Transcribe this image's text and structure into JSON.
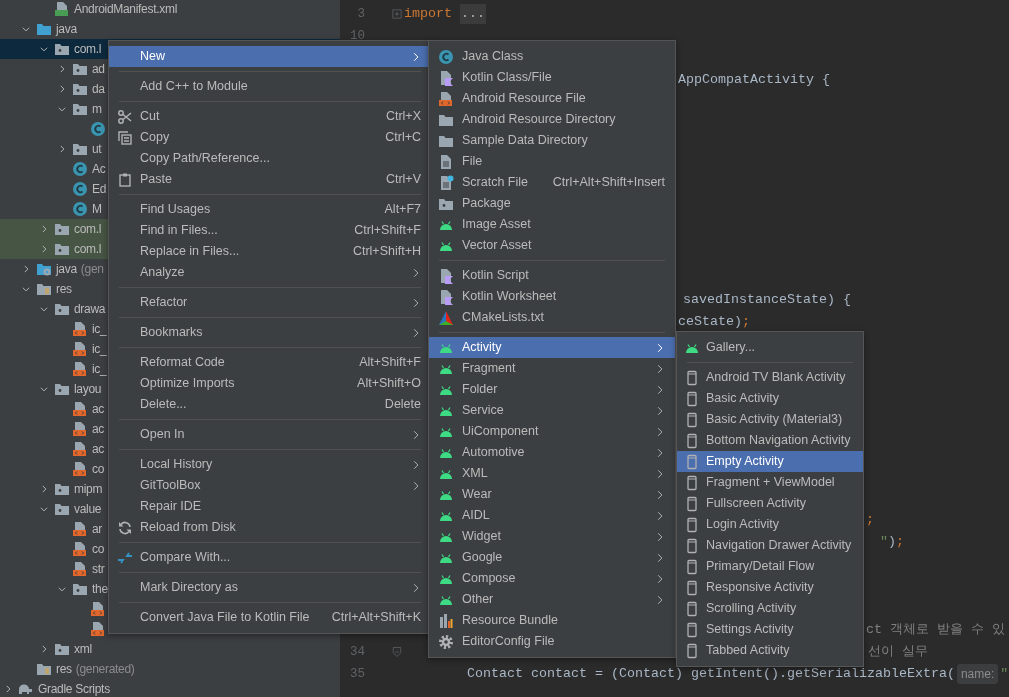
{
  "tree": {
    "items": [
      {
        "children": [
          {
            "children": [
              {
                "kind": "manifest",
                "label": "AndroidManifest.xml",
                "selected": false,
                "tinted": false
              }
            ]
          },
          {
            "kind": "javaroot",
            "label": "java",
            "expanded": true,
            "selected": false,
            "tinted": false,
            "children": [
              {
                "kind": "package",
                "label": "com.l",
                "expanded": true,
                "selected": true,
                "tinted": false,
                "children": [
                  {
                    "kind": "package",
                    "label": "ad",
                    "expanded": false,
                    "selected": false,
                    "tinted": false
                  },
                  {
                    "kind": "package",
                    "label": "da",
                    "expanded": false,
                    "selected": false,
                    "tinted": false
                  },
                  {
                    "kind": "package",
                    "label": "m",
                    "expanded": true,
                    "selected": false,
                    "tinted": false,
                    "children": [
                      {
                        "kind": "class",
                        "selected": false,
                        "tinted": false
                      }
                    ]
                  },
                  {
                    "kind": "package",
                    "label": "ut",
                    "expanded": false,
                    "selected": false,
                    "tinted": false
                  },
                  {
                    "kind": "class",
                    "label": "Ac",
                    "selected": false,
                    "tinted": false
                  },
                  {
                    "kind": "class",
                    "label": "Ed",
                    "selected": false,
                    "tinted": false
                  },
                  {
                    "kind": "class",
                    "label": "M",
                    "selected": false,
                    "tinted": false
                  }
                ]
              },
              {
                "kind": "package",
                "label": "com.l",
                "expanded": false,
                "selected": false,
                "tinted": true
              },
              {
                "kind": "package",
                "label": "com.l",
                "expanded": false,
                "selected": false,
                "tinted": true
              }
            ]
          },
          {
            "kind": "genroot",
            "label": "java",
            "note": "(gen",
            "expanded": false,
            "selected": false,
            "tinted": false
          },
          {
            "kind": "resroot",
            "label": "res",
            "expanded": true,
            "selected": false,
            "tinted": false,
            "children": [
              {
                "kind": "package",
                "label": "drawa",
                "expanded": true,
                "selected": false,
                "tinted": false,
                "children": [
                  {
                    "kind": "xml",
                    "label": "ic_",
                    "selected": false,
                    "tinted": false
                  },
                  {
                    "kind": "xml",
                    "label": "ic_",
                    "selected": false,
                    "tinted": false
                  },
                  {
                    "kind": "xml",
                    "label": "ic_",
                    "selected": false,
                    "tinted": false
                  }
                ]
              },
              {
                "kind": "package",
                "label": "layou",
                "expanded": true,
                "selected": false,
                "tinted": false,
                "children": [
                  {
                    "kind": "xml",
                    "label": "ac",
                    "selected": false,
                    "tinted": false
                  },
                  {
                    "kind": "xml",
                    "label": "ac",
                    "selected": false,
                    "tinted": false
                  },
                  {
                    "kind": "xml",
                    "label": "ac",
                    "selected": false,
                    "tinted": false
                  },
                  {
                    "kind": "xml",
                    "label": "co",
                    "selected": false,
                    "tinted": false
                  }
                ]
              },
              {
                "kind": "package",
                "label": "mipm",
                "expanded": false,
                "selected": false,
                "tinted": false
              },
              {
                "kind": "package",
                "label": "value",
                "expanded": true,
                "selected": false,
                "tinted": false,
                "children": [
                  {
                    "kind": "xml",
                    "label": "ar",
                    "selected": false,
                    "tinted": false
                  },
                  {
                    "kind": "xml",
                    "label": "co",
                    "selected": false,
                    "tinted": false
                  },
                  {
                    "kind": "xml",
                    "label": "str",
                    "selected": false,
                    "tinted": false
                  },
                  {
                    "kind": "package",
                    "label": "the",
                    "expanded": true,
                    "selected": false,
                    "tinted": false,
                    "children": [
                      {
                        "kind": "xml",
                        "selected": false,
                        "tinted": false
                      },
                      {
                        "kind": "xml",
                        "selected": false,
                        "tinted": false
                      }
                    ]
                  }
                ]
              },
              {
                "kind": "package",
                "label": "xml",
                "expanded": false,
                "selected": false,
                "tinted": false
              }
            ]
          },
          {
            "kind": "resroot",
            "label": "res",
            "note": "(generated)",
            "selected": false,
            "tinted": false
          }
        ]
      },
      {
        "kind": "gradle",
        "label": "Gradle Scripts",
        "expanded": false,
        "selected": false,
        "tinted": false
      }
    ]
  },
  "editor": {
    "rows": [
      {
        "number": "3",
        "folded": true,
        "code": [
          {
            "kind": "keyword",
            "text": "import"
          },
          {
            "kind": "fold",
            "text": "..."
          }
        ]
      },
      {
        "number": "10"
      },
      {},
      {
        "code": [
          {
            "kind": "plain",
            "text": "AppCompatActivity {"
          }
        ]
      },
      {},
      {},
      {},
      {},
      {},
      {},
      {},
      {},
      {},
      {
        "code": [
          {
            "kind": "plain",
            "text": "savedInstanceState) {"
          }
        ]
      },
      {
        "code": [
          {
            "kind": "plain",
            "text": "ceState)"
          },
          {
            "kind": "keyword",
            "text": ";"
          }
        ]
      },
      {},
      {},
      {},
      {},
      {},
      {},
      {},
      {},
      {
        "code": [
          {
            "kind": "keyword",
            "text": ";"
          }
        ]
      },
      {
        "code": [
          {
            "kind": "string",
            "text": "\""
          },
          {
            "kind": "plain",
            "text": ")"
          },
          {
            "kind": "keyword",
            "text": ";"
          }
        ]
      },
      {},
      {},
      {},
      {
        "code": [
          {
            "kind": "comment",
            "text": "ct 객체로 받을 수 있"
          }
        ]
      },
      {
        "number": "34",
        "fold_end": true,
        "code": [
          {
            "kind": "comment",
            "text": "선이 실무"
          }
        ]
      },
      {
        "number": "35",
        "code": [
          {
            "kind": "plain",
            "text": "Contact contact = (Contact) getIntent().getSerializableExtra("
          },
          {
            "kind": "hint",
            "text": "name:"
          },
          {
            "kind": "string",
            "text": "\""
          }
        ]
      }
    ]
  },
  "context_menu": {
    "items": [
      {
        "kind": "plain",
        "label": "New",
        "submenu": true,
        "selected": true
      },
      {
        "kind": "separator"
      },
      {
        "kind": "plain",
        "label": "Add C++ to Module",
        "selected": false
      },
      {
        "kind": "separator"
      },
      {
        "kind": "scissors",
        "label": "Cut",
        "shortcut": "Ctrl+X",
        "selected": false
      },
      {
        "kind": "copy",
        "label": "Copy",
        "shortcut": "Ctrl+C",
        "selected": false
      },
      {
        "kind": "plain",
        "label": "Copy Path/Reference...",
        "selected": false
      },
      {
        "kind": "paste",
        "label": "Paste",
        "shortcut": "Ctrl+V",
        "selected": false
      },
      {
        "kind": "separator"
      },
      {
        "kind": "plain",
        "label": "Find Usages",
        "shortcut": "Alt+F7",
        "selected": false
      },
      {
        "kind": "plain",
        "label": "Find in Files...",
        "shortcut": "Ctrl+Shift+F",
        "selected": false
      },
      {
        "kind": "plain",
        "label": "Replace in Files...",
        "shortcut": "Ctrl+Shift+H",
        "selected": false
      },
      {
        "kind": "plain",
        "label": "Analyze",
        "submenu": true,
        "selected": false
      },
      {
        "kind": "separator"
      },
      {
        "kind": "plain",
        "label": "Refactor",
        "submenu": true,
        "selected": false
      },
      {
        "kind": "separator"
      },
      {
        "kind": "plain",
        "label": "Bookmarks",
        "submenu": true,
        "selected": false
      },
      {
        "kind": "separator"
      },
      {
        "kind": "plain",
        "label": "Reformat Code",
        "shortcut": "Alt+Shift+F",
        "selected": false
      },
      {
        "kind": "plain",
        "label": "Optimize Imports",
        "shortcut": "Alt+Shift+O",
        "selected": false
      },
      {
        "kind": "plain",
        "label": "Delete...",
        "shortcut": "Delete",
        "selected": false
      },
      {
        "kind": "separator"
      },
      {
        "kind": "plain",
        "label": "Open In",
        "submenu": true,
        "selected": false
      },
      {
        "kind": "separator"
      },
      {
        "kind": "plain",
        "label": "Local History",
        "submenu": true,
        "selected": false
      },
      {
        "kind": "plain",
        "label": "GitToolBox",
        "submenu": true,
        "selected": false
      },
      {
        "kind": "plain",
        "label": "Repair IDE",
        "selected": false
      },
      {
        "kind": "reload",
        "label": "Reload from Disk",
        "selected": false
      },
      {
        "kind": "separator"
      },
      {
        "kind": "compare",
        "label": "Compare With...",
        "selected": false
      },
      {
        "kind": "separator"
      },
      {
        "kind": "plain",
        "label": "Mark Directory as",
        "submenu": true,
        "selected": false
      },
      {
        "kind": "separator"
      },
      {
        "kind": "plain",
        "label": "Convert Java File to Kotlin File",
        "shortcut": "Ctrl+Alt+Shift+K",
        "selected": false
      }
    ]
  },
  "new_submenu": {
    "items": [
      {
        "kind": "class",
        "label": "Java Class",
        "selected": false
      },
      {
        "kind": "kotlin",
        "label": "Kotlin Class/File",
        "selected": false
      },
      {
        "kind": "xml",
        "label": "Android Resource File",
        "selected": false
      },
      {
        "kind": "folder",
        "label": "Android Resource Directory",
        "selected": false
      },
      {
        "kind": "folder",
        "label": "Sample Data Directory",
        "selected": false
      },
      {
        "kind": "file",
        "label": "File",
        "selected": false
      },
      {
        "kind": "scratch",
        "label": "Scratch File",
        "shortcut": "Ctrl+Alt+Shift+Insert",
        "selected": false
      },
      {
        "kind": "package",
        "label": "Package",
        "selected": false
      },
      {
        "kind": "android",
        "label": "Image Asset",
        "selected": false
      },
      {
        "kind": "android",
        "label": "Vector Asset",
        "selected": false
      },
      {
        "kind": "separator"
      },
      {
        "kind": "kotlin",
        "label": "Kotlin Script",
        "selected": false
      },
      {
        "kind": "kotlin",
        "label": "Kotlin Worksheet",
        "selected": false
      },
      {
        "kind": "cmake",
        "label": "CMakeLists.txt",
        "selected": false
      },
      {
        "kind": "separator"
      },
      {
        "kind": "android",
        "label": "Activity",
        "submenu": true,
        "selected": true
      },
      {
        "kind": "android",
        "label": "Fragment",
        "submenu": true,
        "selected": false
      },
      {
        "kind": "android",
        "label": "Folder",
        "submenu": true,
        "selected": false
      },
      {
        "kind": "android",
        "label": "Service",
        "submenu": true,
        "selected": false
      },
      {
        "kind": "android",
        "label": "UiComponent",
        "submenu": true,
        "selected": false
      },
      {
        "kind": "android",
        "label": "Automotive",
        "submenu": true,
        "selected": false
      },
      {
        "kind": "android",
        "label": "XML",
        "submenu": true,
        "selected": false
      },
      {
        "kind": "android",
        "label": "Wear",
        "submenu": true,
        "selected": false
      },
      {
        "kind": "android",
        "label": "AIDL",
        "submenu": true,
        "selected": false
      },
      {
        "kind": "android",
        "label": "Widget",
        "submenu": true,
        "selected": false
      },
      {
        "kind": "android",
        "label": "Google",
        "submenu": true,
        "selected": false
      },
      {
        "kind": "android",
        "label": "Compose",
        "submenu": true,
        "selected": false
      },
      {
        "kind": "android",
        "label": "Other",
        "submenu": true,
        "selected": false
      },
      {
        "kind": "bundle",
        "label": "Resource Bundle",
        "selected": false
      },
      {
        "kind": "gear",
        "label": "EditorConfig File",
        "selected": false
      }
    ]
  },
  "activity_submenu": {
    "items": [
      {
        "kind": "android",
        "label": "Gallery...",
        "selected": false
      },
      {
        "kind": "separator"
      },
      {
        "kind": "phone",
        "label": "Android TV Blank Activity",
        "selected": false
      },
      {
        "kind": "phone",
        "label": "Basic Activity",
        "selected": false
      },
      {
        "kind": "phone",
        "label": "Basic Activity (Material3)",
        "selected": false
      },
      {
        "kind": "phone",
        "label": "Bottom Navigation Activity",
        "selected": false
      },
      {
        "kind": "phone",
        "label": "Empty Activity",
        "selected": true
      },
      {
        "kind": "phone",
        "label": "Fragment + ViewModel",
        "selected": false
      },
      {
        "kind": "phone",
        "label": "Fullscreen Activity",
        "selected": false
      },
      {
        "kind": "phone",
        "label": "Login Activity",
        "selected": false
      },
      {
        "kind": "phone",
        "label": "Navigation Drawer Activity",
        "selected": false
      },
      {
        "kind": "phone",
        "label": "Primary/Detail Flow",
        "selected": false
      },
      {
        "kind": "phone",
        "label": "Responsive Activity",
        "selected": false
      },
      {
        "kind": "phone",
        "label": "Scrolling Activity",
        "selected": false
      },
      {
        "kind": "phone",
        "label": "Settings Activity",
        "selected": false
      },
      {
        "kind": "phone",
        "label": "Tabbed Activity",
        "selected": false
      }
    ]
  }
}
